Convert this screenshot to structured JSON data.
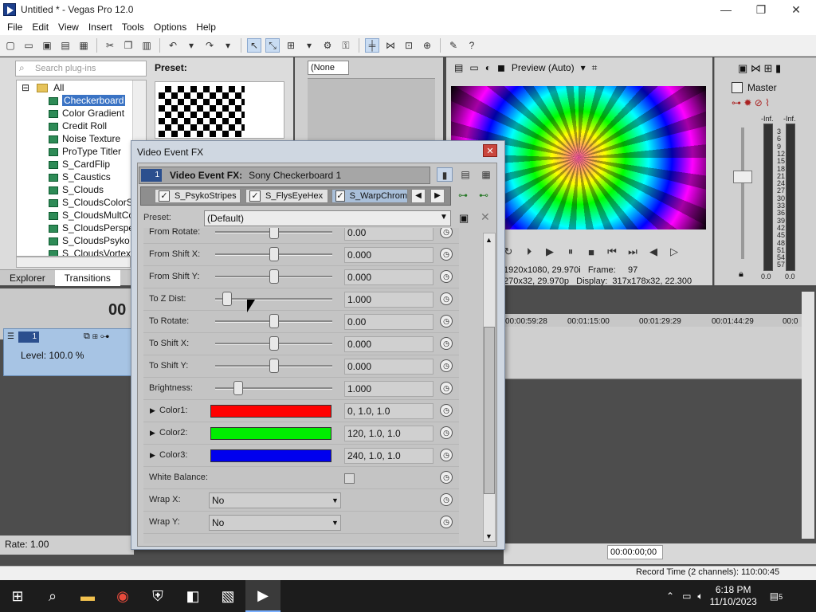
{
  "window": {
    "title": "Untitled * - Vegas Pro 12.0",
    "minimize": "—",
    "maximize": "❐",
    "close": "✕"
  },
  "menu": [
    "File",
    "Edit",
    "View",
    "Insert",
    "Tools",
    "Options",
    "Help"
  ],
  "plugins": {
    "search_placeholder": "Search plug-ins",
    "root": "All",
    "items": [
      "Checkerboard",
      "Color Gradient",
      "Credit Roll",
      "Noise Texture",
      "ProType Titler",
      "S_CardFlip",
      "S_Caustics",
      "S_Clouds",
      "S_CloudsColorSm",
      "S_CloudsMultCol",
      "S_CloudsPerspe",
      "S_CloudsPsyko",
      "S_CloudsVortex"
    ],
    "selected": "Checkerboard",
    "preset_label": "Preset:"
  },
  "left_tabs": [
    "Explorer",
    "Transitions"
  ],
  "mid_panel": {
    "dropdown": "(None"
  },
  "preview": {
    "mode": "Preview (Auto)",
    "project": "1920x1080, 29.970i",
    "preview_res": "270x32, 29.970p",
    "frame_label": "Frame:",
    "frame": "97",
    "display_label": "Display:",
    "display": "317x178x32, 22.300"
  },
  "master": {
    "label": "Master",
    "inf_l": "-Inf.",
    "inf_r": "-Inf.",
    "scale": [
      "3",
      "6",
      "9",
      "12",
      "15",
      "18",
      "21",
      "24",
      "27",
      "30",
      "33",
      "36",
      "39",
      "42",
      "45",
      "48",
      "51",
      "54",
      "57"
    ],
    "bottom_l": "0.0",
    "bottom_r": "0.0"
  },
  "timeline": {
    "timecode": "00",
    "track_number": "1",
    "level": "Level: 100.0 %",
    "ruler": [
      "00:00:59:28",
      "00:01:15:00",
      "00:01:29:29",
      "00:01:44:29",
      "00:0"
    ],
    "rate": "Rate: 1.00",
    "bottom_timecode": "00:00:00;00",
    "status": "Record Time (2 channels): 110:00:45"
  },
  "dialog": {
    "title": "Video Event FX",
    "fx_badge": "1",
    "fx_label": "Video Event FX:",
    "fx_name": "Sony Checkerboard 1",
    "chain": [
      "S_PsykoStripes",
      "S_FlysEyeHex",
      "S_WarpChrom"
    ],
    "preset_label": "Preset:",
    "preset_value": "(Default)",
    "params": [
      {
        "label": "From Rotate:",
        "value": "0.00",
        "slider": 0.5
      },
      {
        "label": "From Shift X:",
        "value": "0.000",
        "slider": 0.5
      },
      {
        "label": "From Shift Y:",
        "value": "0.000",
        "slider": 0.5
      },
      {
        "label": "To Z Dist:",
        "value": "1.000",
        "slider": 0.1
      },
      {
        "label": "To Rotate:",
        "value": "0.00",
        "slider": 0.5
      },
      {
        "label": "To Shift X:",
        "value": "0.000",
        "slider": 0.5
      },
      {
        "label": "To Shift Y:",
        "value": "0.000",
        "slider": 0.5
      },
      {
        "label": "Brightness:",
        "value": "1.000",
        "slider": 0.2
      },
      {
        "label": "Color1:",
        "value": "0, 1.0, 1.0",
        "color": "#ff0000"
      },
      {
        "label": "Color2:",
        "value": "120, 1.0, 1.0",
        "color": "#00ee00"
      },
      {
        "label": "Color3:",
        "value": "240, 1.0, 1.0",
        "color": "#0000ee"
      },
      {
        "label": "White Balance:",
        "checkbox": true
      },
      {
        "label": "Wrap X:",
        "dropdown": "No"
      },
      {
        "label": "Wrap Y:",
        "dropdown": "No"
      }
    ]
  },
  "taskbar": {
    "time": "6:18 PM",
    "date": "11/10/2023",
    "notifications": "5"
  },
  "colors": {
    "accent": "#3a73c4",
    "dialog_frame": "#cfd7e1"
  }
}
